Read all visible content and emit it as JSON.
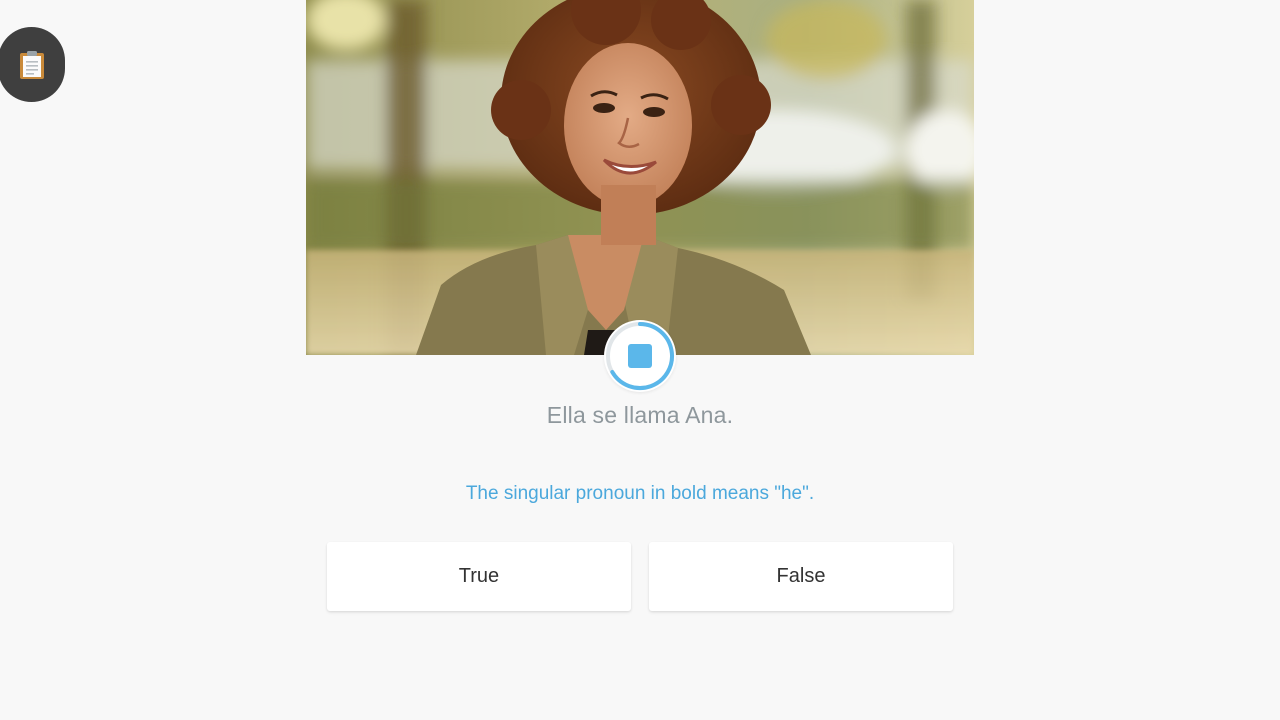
{
  "toolbar": {
    "notes_icon": "clipboard-icon"
  },
  "media": {
    "photo_icon": "portrait-photo",
    "audio_icon": "stop-icon"
  },
  "exercise": {
    "sentence": "Ella se llama Ana.",
    "question": "The singular pronoun in bold means \"he\".",
    "answers": [
      {
        "label": "True"
      },
      {
        "label": "False"
      }
    ]
  },
  "colors": {
    "background": "#f8f8f8",
    "accent": "#4ba8dc",
    "sentence_text": "#8e979c",
    "notes_button": "#3f3f3f"
  }
}
